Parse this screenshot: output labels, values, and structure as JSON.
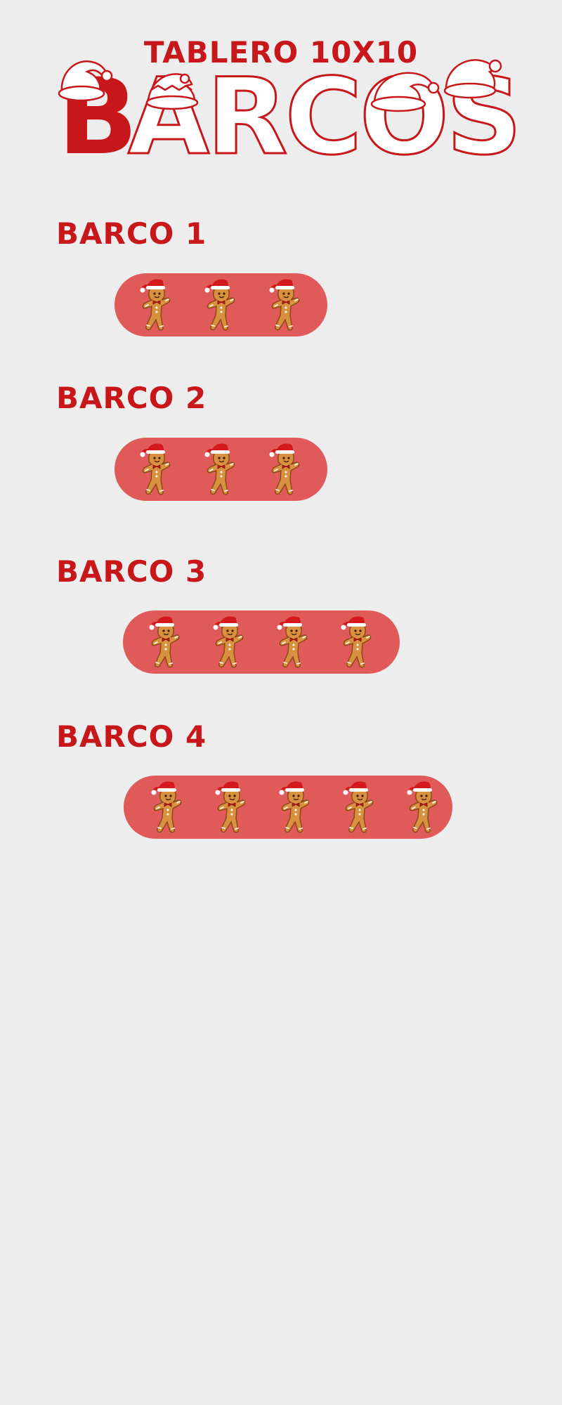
{
  "header": {
    "subtitle": "TABLERO 10X10",
    "title": "BARCOS"
  },
  "ships": [
    {
      "label": "BARCO 1",
      "segments": 3
    },
    {
      "label": "BARCO 2",
      "segments": 3
    },
    {
      "label": "BARCO 3",
      "segments": 4
    },
    {
      "label": "BARCO 4",
      "segments": 5
    }
  ],
  "colors": {
    "accent": "#c8171a",
    "ship_fill": "#e05a5a",
    "background": "#ededed"
  },
  "icons": {
    "segment": "gingerbread-man-icon",
    "decoration": "santa-hat-icon"
  }
}
